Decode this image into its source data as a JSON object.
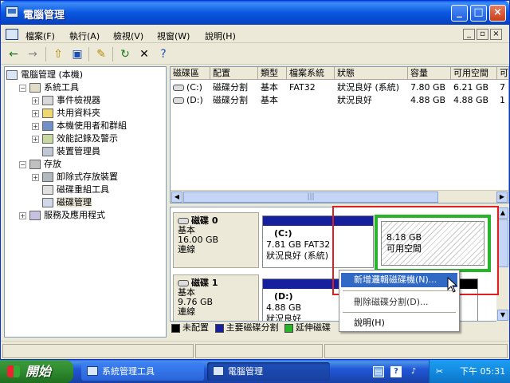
{
  "window": {
    "title": "電腦管理",
    "min": "_",
    "max": "□",
    "close": "×"
  },
  "menu": {
    "items": [
      "檔案(F)",
      "執行(A)",
      "檢視(V)",
      "視窗(W)",
      "說明(H)"
    ],
    "mdi": [
      "_",
      "♫",
      "×"
    ]
  },
  "toolbar": {
    "icons": [
      "back-icon",
      "forward-icon",
      "up-folder-icon",
      "show-hide-tree-icon",
      "properties-icon",
      "refresh-icon",
      "delete-icon",
      "help-icon"
    ],
    "glyphs": [
      "←",
      "→",
      "⇧",
      "▣",
      "✎",
      "↻",
      "✕",
      "?"
    ]
  },
  "tree": {
    "items": [
      {
        "label": "電腦管理 (本機)",
        "pm": "",
        "indent": 0
      },
      {
        "label": "系統工具",
        "pm": "−",
        "indent": 1
      },
      {
        "label": "事件檢視器",
        "pm": "+",
        "indent": 2
      },
      {
        "label": "共用資料夾",
        "pm": "+",
        "indent": 2
      },
      {
        "label": "本機使用者和群組",
        "pm": "+",
        "indent": 2
      },
      {
        "label": "效能記錄及警示",
        "pm": "+",
        "indent": 2
      },
      {
        "label": "裝置管理員",
        "pm": "",
        "indent": 2
      },
      {
        "label": "存放",
        "pm": "−",
        "indent": 1
      },
      {
        "label": "卸除式存放裝置",
        "pm": "+",
        "indent": 2
      },
      {
        "label": "磁碟重組工具",
        "pm": "",
        "indent": 2
      },
      {
        "label": "磁碟管理",
        "pm": "",
        "indent": 2
      },
      {
        "label": "服務及應用程式",
        "pm": "+",
        "indent": 1
      }
    ]
  },
  "volumes": {
    "headers": [
      "磁碟區",
      "配置",
      "類型",
      "檔案系統",
      "狀態",
      "容量",
      "可用空間",
      "可"
    ],
    "rows": [
      [
        "(C:)",
        "磁碟分割",
        "基本",
        "FAT32",
        "狀況良好 (系統)",
        "7.80 GB",
        "6.21 GB",
        "7"
      ],
      [
        "(D:)",
        "磁碟分割",
        "基本",
        "",
        "狀況良好",
        "4.88 GB",
        "4.88 GB",
        "1"
      ]
    ],
    "scroll_thumb": "|||"
  },
  "disks": [
    {
      "name": "磁碟 0",
      "type": "基本",
      "size": "16.00 GB",
      "status": "連線",
      "primary": {
        "letter": "(C:)",
        "info": "7.81 GB FAT32",
        "status": "狀況良好 (系統)"
      },
      "extended": {
        "size": "8.18 GB",
        "label": "可用空間"
      }
    },
    {
      "name": "磁碟 1",
      "type": "基本",
      "size": "9.76 GB",
      "status": "連線",
      "primary": {
        "letter": "(D:)",
        "info": "4.88 GB",
        "status": "狀況良好"
      }
    }
  ],
  "legend": [
    {
      "label": "未配置",
      "color": "#000000"
    },
    {
      "label": "主要磁碟分割",
      "color": "#16209d"
    },
    {
      "label": "延伸磁碟",
      "color": "#28b428"
    }
  ],
  "context_menu": {
    "items": [
      "新增邏輯磁碟機(N)...",
      "刪除磁碟分割(D)...",
      "說明(H)"
    ]
  },
  "taskbar": {
    "start": "開始",
    "tasks": [
      "系統管理工具",
      "電腦管理"
    ],
    "time": "下午 05:31"
  },
  "colors": {
    "primary_partition": "#16209d",
    "extended_partition": "#28b428",
    "highlight": "#316ac5"
  }
}
